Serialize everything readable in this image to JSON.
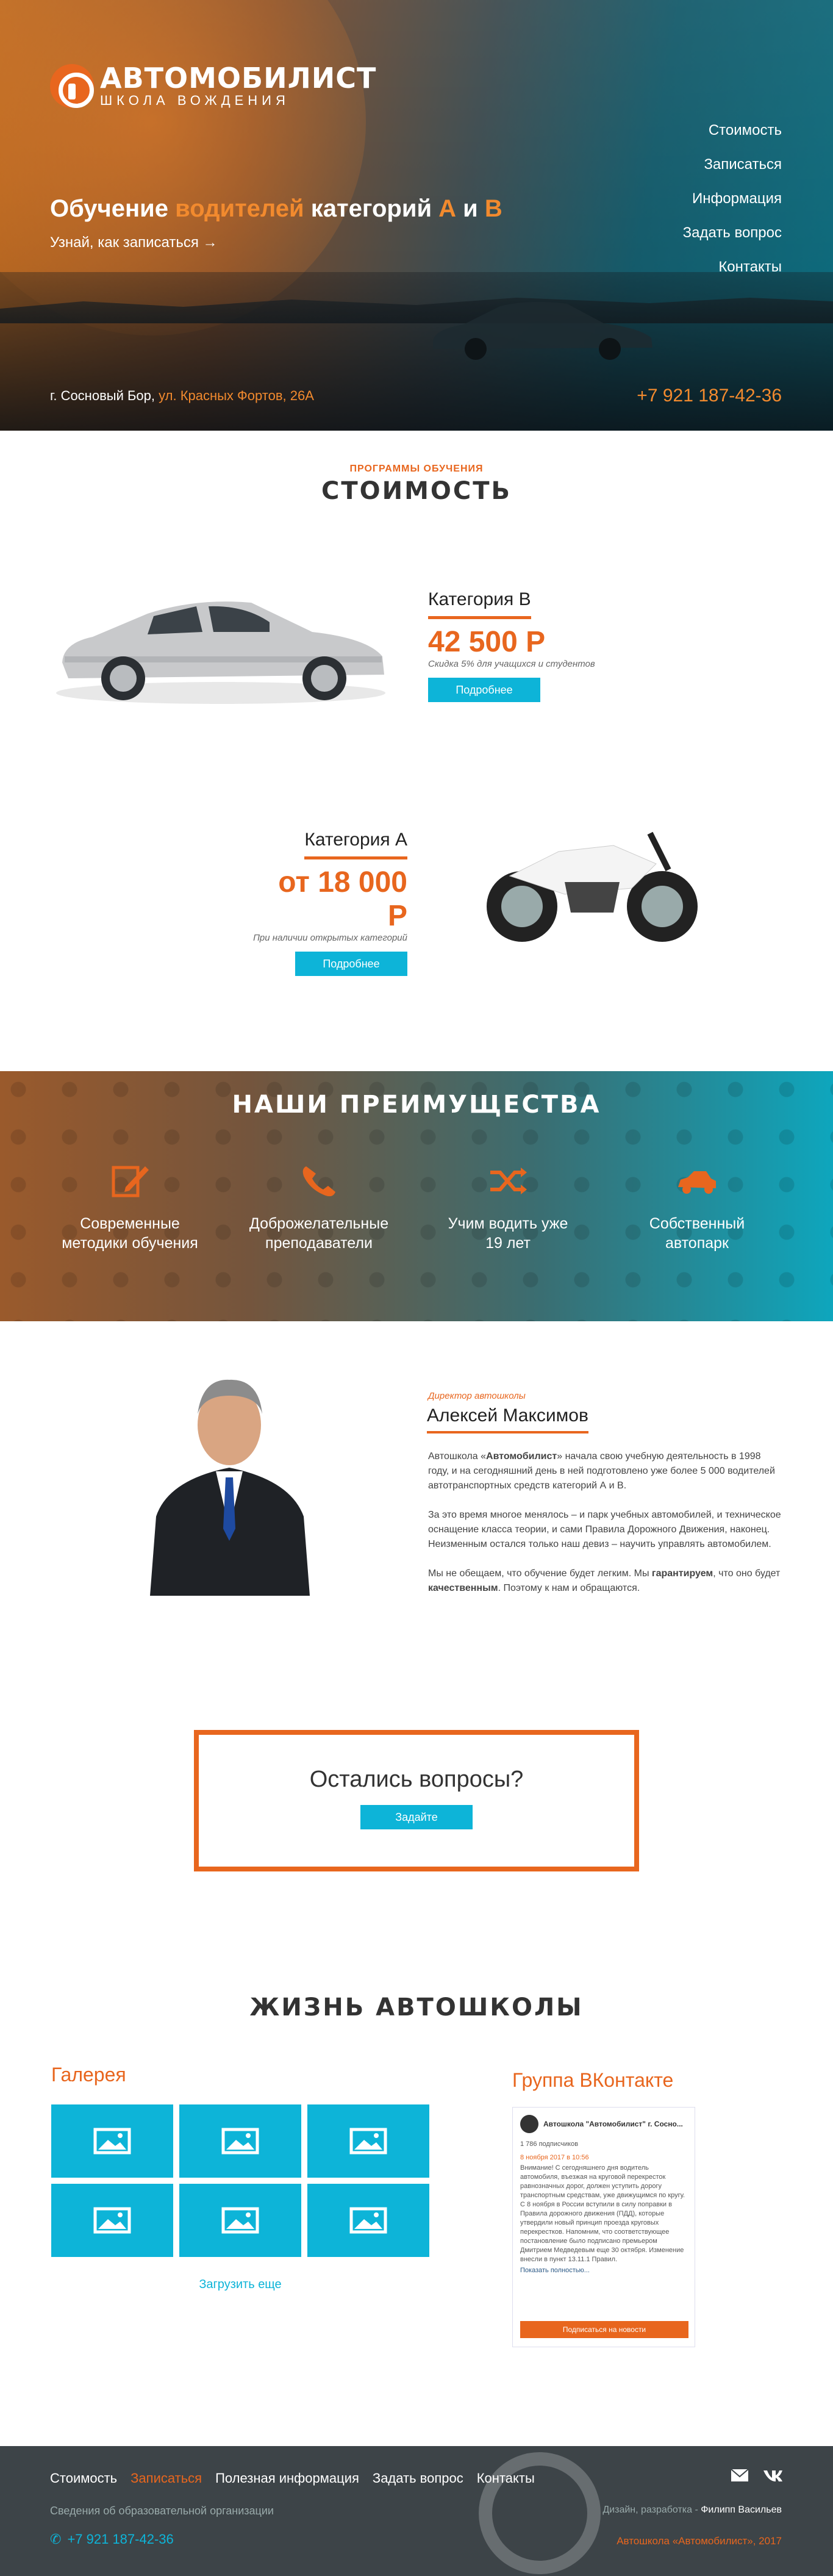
{
  "colors": {
    "accent": "#e8661e",
    "blue": "#0db4d8"
  },
  "hero": {
    "logo_title": "АВТОМОБИЛИСТ",
    "logo_subtitle": "ШКОЛА ВОЖДЕНИЯ",
    "nav": [
      "Стоимость",
      "Записаться",
      "Информация",
      "Задать вопрос",
      "Контакты"
    ],
    "headline_1": "Обучение ",
    "headline_2": "водителей",
    "headline_3": " категорий ",
    "headline_4": "А",
    "headline_5": " и ",
    "headline_6": "В",
    "subline": "Узнай, как записаться →",
    "address_1": "г. Сосновый Бор, ",
    "address_2": "ул. Красных Фортов, 26А",
    "phone": "+7 921 187-42-36"
  },
  "prices": {
    "kicker": "ПРОГРАММЫ ОБУЧЕНИЯ",
    "title": "СТОИМОСТЬ",
    "cards": [
      {
        "title": "Категория В",
        "price": "42 500 Р",
        "note": "Скидка 5% для учащихся и студентов",
        "button": "Подробнее",
        "vehicle": "car-image"
      },
      {
        "title": "Категория А",
        "price": "от 18 000 Р",
        "note": "При наличии открытых категорий",
        "button": "Подробнее",
        "vehicle": "motorcycle-image"
      }
    ]
  },
  "advantages": {
    "title": "НАШИ ПРЕИМУЩЕСТВА",
    "items": [
      {
        "icon": "edit-icon",
        "line1": "Современные",
        "line2": "методики обучения"
      },
      {
        "icon": "phone-icon",
        "line1": "Доброжелательные",
        "line2": "преподаватели"
      },
      {
        "icon": "shuffle-icon",
        "line1": "Учим водить уже",
        "line2": "19 лет"
      },
      {
        "icon": "car-icon",
        "line1": "Собственный",
        "line2": "автопарк"
      }
    ]
  },
  "director": {
    "role": "Директор автошколы",
    "name": "Алексей Максимов",
    "p1_a": "Автошкола «",
    "p1_b": "Автомобилист",
    "p1_c": "» начала свою учебную деятельность в 1998 году, и на сегодняшний день в ней подготовлено уже более 5 000 водителей автотранспортных средств категорий А и В.",
    "p2": "За это время многое менялось – и парк учебных автомобилей, и техническое оснащение класса теории, и сами Правила Дорожного Движения, наконец. Неизменным остался только наш девиз – научить управлять автомобилем.",
    "p3_a": "Мы не обещаем, что обучение будет легким. Мы ",
    "p3_b": "гарантируем",
    "p3_c": ", что оно будет ",
    "p3_d": "качественным",
    "p3_e": ". Поэтому к нам и обращаются."
  },
  "question": {
    "title": "Остались вопросы?",
    "button": "Задайте"
  },
  "life": {
    "title": "ЖИЗНЬ АВТОШКОЛЫ",
    "gallery_title": "Галерея",
    "load_more": "Загрузить еще",
    "vk_title": "Группа ВКонтакте",
    "vk_group": "Автошкола \"Автомобилист\" г. Сосно...",
    "vk_members": "1 786 подписчиков",
    "vk_date": "8 ноября 2017 в 10:56",
    "vk_post": "Внимание! С сегодняшнего дня водитель автомобиля, въезжая на круговой перекресток равнозначных дорог, должен уступить дорогу транспортным средствам, уже движущимся по кругу. С 8 ноября в России вступили в силу поправки в Правила дорожного движения (ПДД), которые утвердили новый принцип проезда круговых перекрестков. Напомним, что соответствующее постановление было подписано премьером Дмитрием Медведевым еще 30 октября. Изменение внесли в пункт 13.11.1 Правил.",
    "vk_more": "Показать полностью...",
    "vk_button": "Подписаться на новости"
  },
  "footer": {
    "nav": [
      "Стоимость",
      "Записаться",
      "Полезная информация",
      "Задать вопрос",
      "Контакты"
    ],
    "info": "Сведения об образовательной организации",
    "phone": "+7 921 187-42-36",
    "credit_a": "Дизайн, разработка - ",
    "credit_b": "Филипп Васильев",
    "copyright": "Автошкола «Автомобилист», 2017"
  }
}
